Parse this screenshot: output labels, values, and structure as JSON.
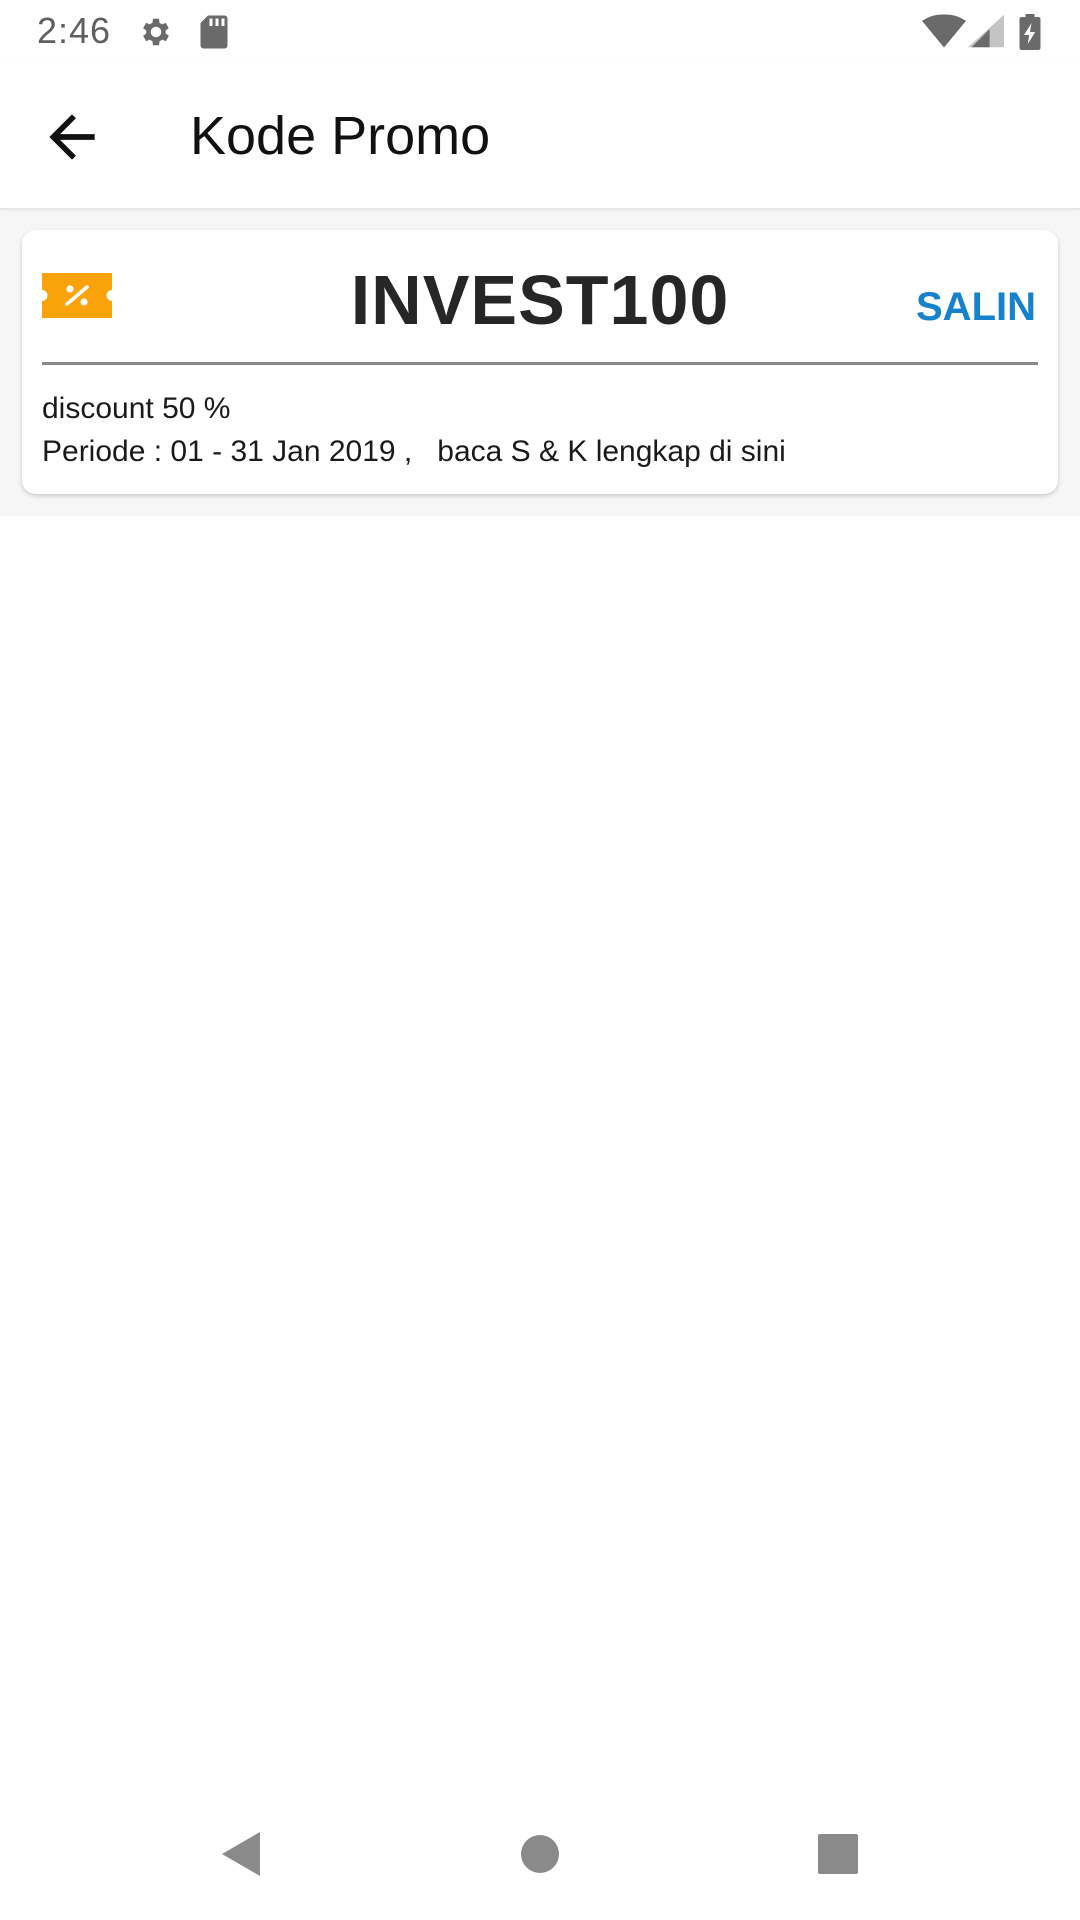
{
  "status_bar": {
    "time": "2:46",
    "icons": [
      "settings-icon",
      "sd-card-icon",
      "wifi-icon",
      "cell-signal-icon",
      "battery-charging-icon"
    ]
  },
  "app_bar": {
    "title": "Kode Promo",
    "back_icon": "arrow-back-icon"
  },
  "promo": {
    "code": "INVEST100",
    "copy_label": "SALIN",
    "description": "discount 50 %",
    "period_prefix": "Periode : 01 - 31 Jan 2019 ,   ",
    "terms_label": "baca S & K lengkap di sini",
    "icon": "voucher-percent-icon",
    "icon_color": "#F9A20A",
    "copy_color": "#1681CC"
  },
  "nav_bar": {
    "icons": [
      "nav-back-icon",
      "nav-home-icon",
      "nav-recents-icon"
    ]
  }
}
